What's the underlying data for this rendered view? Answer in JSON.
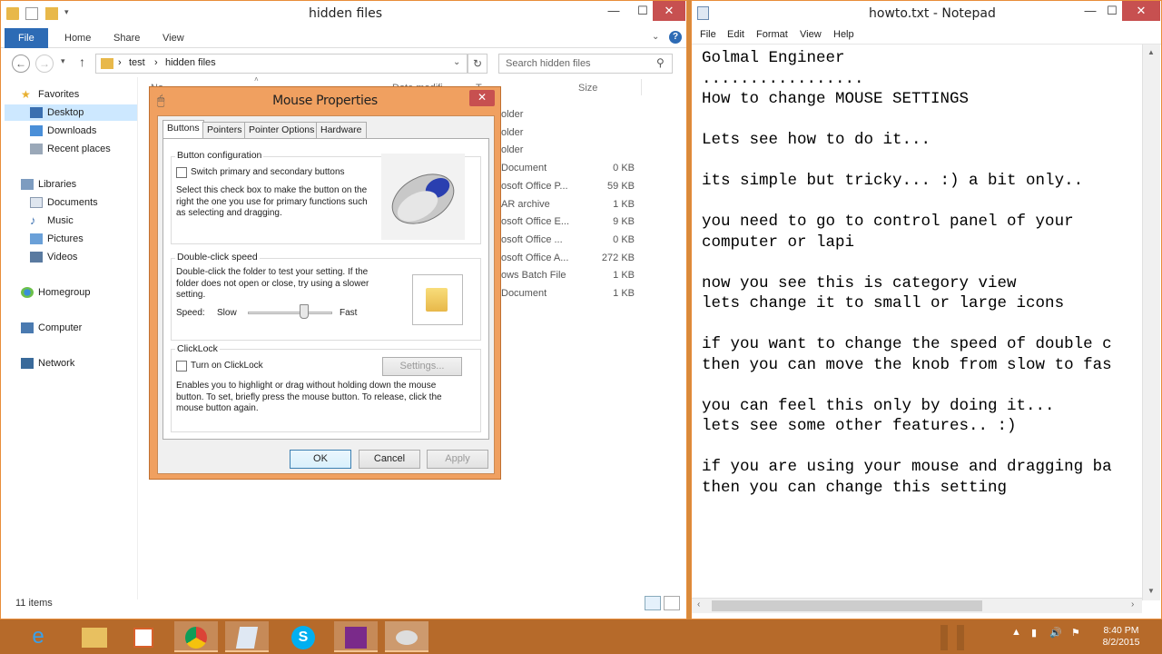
{
  "explorer": {
    "title": "hidden files",
    "tabs": {
      "file": "File",
      "home": "Home",
      "share": "Share",
      "view": "View"
    },
    "breadcrumb": [
      "test",
      "hidden files"
    ],
    "search_placeholder": "Search hidden files",
    "column_size": "Size",
    "column_name_partial": "Na",
    "column_modified_partial": "Date modifi",
    "column_type_partial": "T",
    "nav": {
      "favorites": "Favorites",
      "desktop": "Desktop",
      "downloads": "Downloads",
      "recent": "Recent places",
      "libraries": "Libraries",
      "documents": "Documents",
      "music": "Music",
      "pictures": "Pictures",
      "videos": "Videos",
      "homegroup": "Homegroup",
      "computer": "Computer",
      "network": "Network"
    },
    "files": [
      {
        "type": "older",
        "size": ""
      },
      {
        "type": "older",
        "size": ""
      },
      {
        "type": "older",
        "size": ""
      },
      {
        "type": "Document",
        "size": "0 KB"
      },
      {
        "type": "osoft Office P...",
        "size": "59 KB"
      },
      {
        "type": "AR archive",
        "size": "1 KB"
      },
      {
        "type": "osoft Office E...",
        "size": "9 KB"
      },
      {
        "type": "osoft Office ...",
        "size": "0 KB"
      },
      {
        "type": "osoft Office A...",
        "size": "272 KB"
      },
      {
        "type": "ows Batch File",
        "size": "1 KB"
      },
      {
        "type": "Document",
        "size": "1 KB"
      }
    ],
    "status": "11 items"
  },
  "dialog": {
    "title": "Mouse Properties",
    "tabs": [
      "Buttons",
      "Pointers",
      "Pointer Options",
      "Hardware"
    ],
    "button_config": {
      "label": "Button configuration",
      "checkbox": "Switch primary and secondary buttons",
      "desc": "Select this check box to make the button on the right the one you use for primary functions such as selecting and dragging."
    },
    "double_click": {
      "label": "Double-click speed",
      "desc": "Double-click the folder to test your setting. If the folder does not open or close, try using a slower setting.",
      "speed": "Speed:",
      "slow": "Slow",
      "fast": "Fast",
      "slider_level": 0.75
    },
    "clicklock": {
      "label": "ClickLock",
      "checkbox": "Turn on ClickLock",
      "settings": "Settings...",
      "desc": "Enables you to highlight or drag without holding down the mouse button. To set, briefly press the mouse button. To release, click the mouse button again."
    },
    "ok": "OK",
    "cancel": "Cancel",
    "apply": "Apply"
  },
  "notepad": {
    "title": "howto.txt - Notepad",
    "menu": [
      "File",
      "Edit",
      "Format",
      "View",
      "Help"
    ],
    "text": "Golmal Engineer\n.................\nHow to change MOUSE SETTINGS\n\nLets see how to do it...\n\nits simple but tricky... :) a bit only..\n\nyou need to go to control panel of your\ncomputer or lapi\n\nnow you see this is category view\nlets change it to small or large icons\n\nif you want to change the speed of double c\nthen you can move the knob from slow to fas\n\nyou can feel this only by doing it...\nlets see some other features.. :)\n\nif you are using your mouse and dragging ba\nthen you can change this setting"
  },
  "taskbar": {
    "time": "8:40 PM",
    "date": "8/2/2015"
  }
}
